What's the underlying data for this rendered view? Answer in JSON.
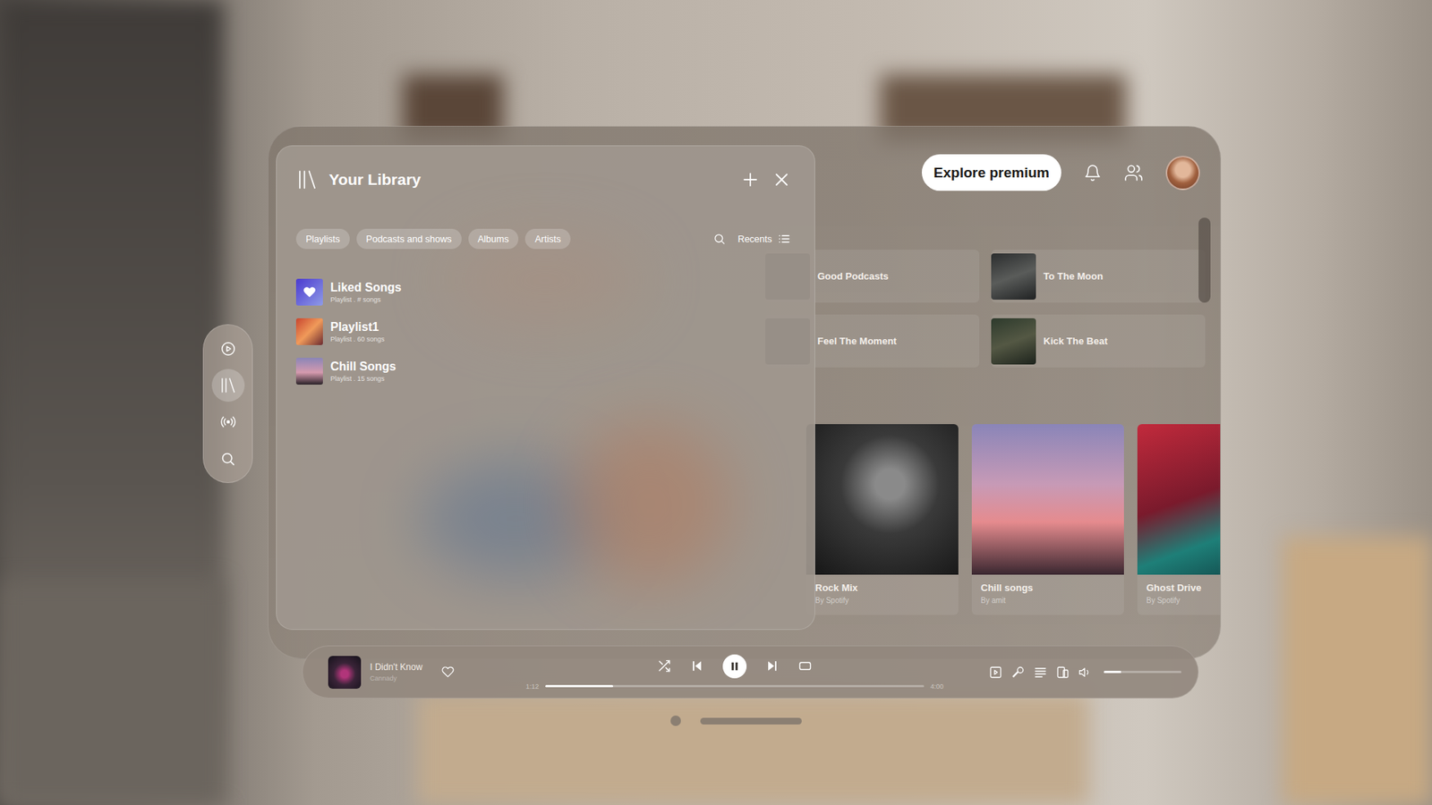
{
  "sidebar": {
    "items": [
      {
        "selected": false
      },
      {
        "selected": true
      },
      {
        "selected": false
      },
      {
        "selected": false
      }
    ]
  },
  "library": {
    "title": "Your Library",
    "filters": [
      {
        "label": "Playlists",
        "selected": false
      },
      {
        "label": "Podcasts and shows",
        "selected": false
      },
      {
        "label": "Albums",
        "selected": false
      },
      {
        "label": "Artists",
        "selected": false
      }
    ],
    "sort": {
      "label": "Recents"
    },
    "items": [
      {
        "title": "Liked Songs",
        "subtitle": "Playlist . # songs",
        "kind": "liked"
      },
      {
        "title": "Playlist1",
        "subtitle": "Playlist . 60 songs",
        "kind": "cover"
      },
      {
        "title": "Chill Songs",
        "subtitle": "Playlist . 15 songs",
        "kind": "cover"
      }
    ]
  },
  "header": {
    "premium_button": "Explore premium"
  },
  "shortcuts": [
    {
      "title": "Good Podcasts"
    },
    {
      "title": "To The Moon"
    },
    {
      "title": "Feel The Moment"
    },
    {
      "title": "Kick The Beat"
    }
  ],
  "albums": [
    {
      "title": "Rock Mix",
      "subtitle": "By Spotify"
    },
    {
      "title": "Chill songs",
      "subtitle": "By amit"
    },
    {
      "title": "Ghost Drive",
      "subtitle": "By Spotify"
    }
  ],
  "player": {
    "track": "I Didn't Know",
    "artist": "Cannady",
    "liked": false,
    "playing": true,
    "elapsed": "1:12",
    "duration": "4:00",
    "progress": 0.18,
    "volume": 0.22
  }
}
